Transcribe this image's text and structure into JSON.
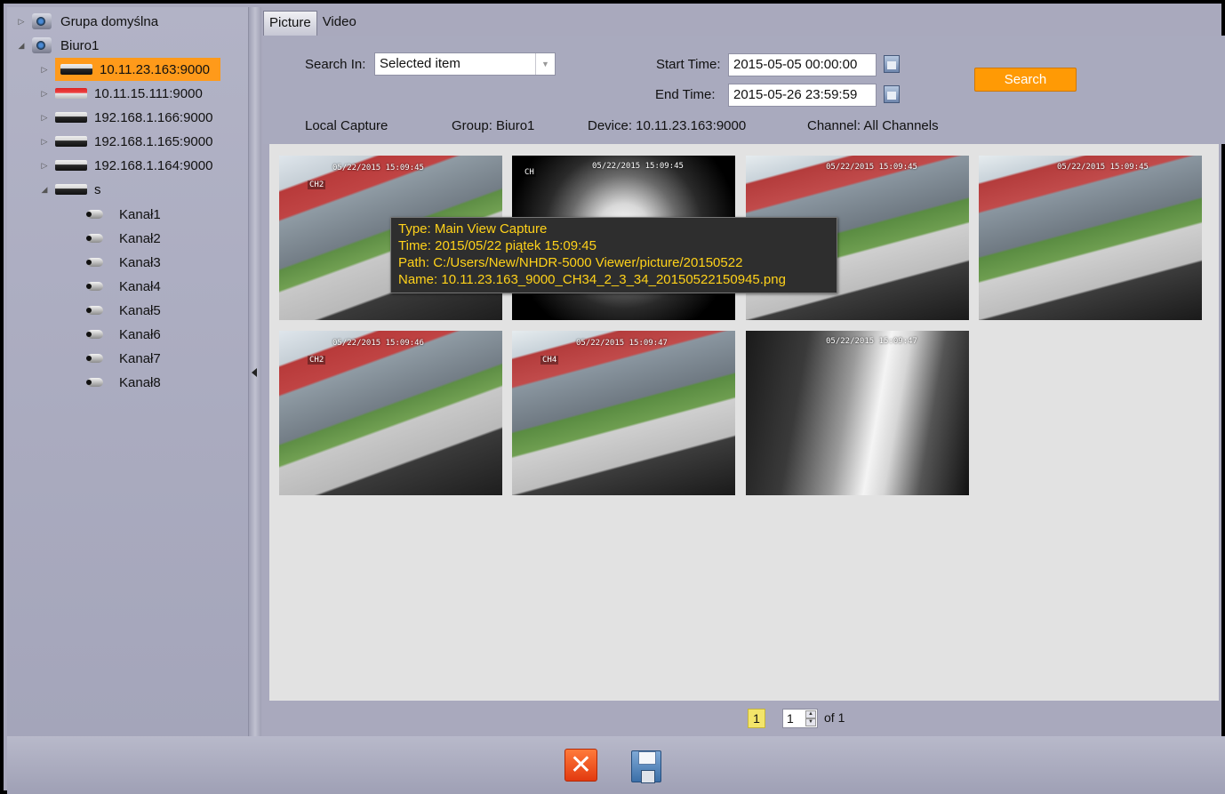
{
  "tree": {
    "groups": [
      {
        "label": "Grupa domyślna",
        "expanded": false
      },
      {
        "label": "Biuro1",
        "expanded": true
      }
    ],
    "devices": [
      {
        "label": "10.11.23.163:9000",
        "selected": true
      },
      {
        "label": "10.11.15.111:9000"
      },
      {
        "label": "192.168.1.166:9000"
      },
      {
        "label": "192.168.1.165:9000"
      },
      {
        "label": "192.168.1.164:9000"
      },
      {
        "label": "s",
        "expanded": true
      }
    ],
    "channels": [
      "Kanał1",
      "Kanał2",
      "Kanał3",
      "Kanał4",
      "Kanał5",
      "Kanał6",
      "Kanał7",
      "Kanał8"
    ]
  },
  "tabs": [
    "Picture",
    "Video"
  ],
  "search": {
    "search_in_label": "Search In:",
    "search_in_value": "Selected item",
    "start_label": "Start Time:",
    "start_value": "2015-05-05 00:00:00",
    "end_label": "End Time:",
    "end_value": "2015-05-26 23:59:59",
    "button": "Search"
  },
  "info": {
    "source": "Local Capture",
    "group": "Group: Biuro1",
    "device": "Device: 10.11.23.163:9000",
    "channel": "Channel: All Channels"
  },
  "thumbnails": [
    {
      "osd": "05/22/2015 15:09:45",
      "ch": "CH2",
      "scene": "street"
    },
    {
      "osd": "05/22/2015 15:09:45",
      "ch": "CH",
      "scene": "ir"
    },
    {
      "osd": "05/22/2015 15:09:45",
      "ch": "",
      "scene": "street2"
    },
    {
      "osd": "05/22/2015 15:09:45",
      "ch": "",
      "scene": "street2"
    },
    {
      "osd": "05/22/2015 15:09:46",
      "ch": "CH2",
      "scene": "street"
    },
    {
      "osd": "05/22/2015 15:09:47",
      "ch": "CH4",
      "scene": "street2"
    },
    {
      "osd": "05/22/2015 15:09:47",
      "ch": "",
      "scene": "glare"
    }
  ],
  "tooltip": {
    "type": "Type: Main View Capture",
    "time": "Time: 2015/05/22 piątek 15:09:45",
    "path": "Path: C:/Users/New/NHDR-5000 Viewer/picture/20150522",
    "name": "Name: 10.11.23.163_9000_CH34_2_3_34_20150522150945.png"
  },
  "pager": {
    "current": "1",
    "spin_value": "1",
    "of": "of 1"
  },
  "actions": {
    "close_icon": "close-icon",
    "save_icon": "floppy-disk-icon"
  },
  "colors": {
    "accent_orange": "#ff9a05",
    "tooltip_text": "#ffd21a",
    "tooltip_bg": "#2e2e2e"
  }
}
